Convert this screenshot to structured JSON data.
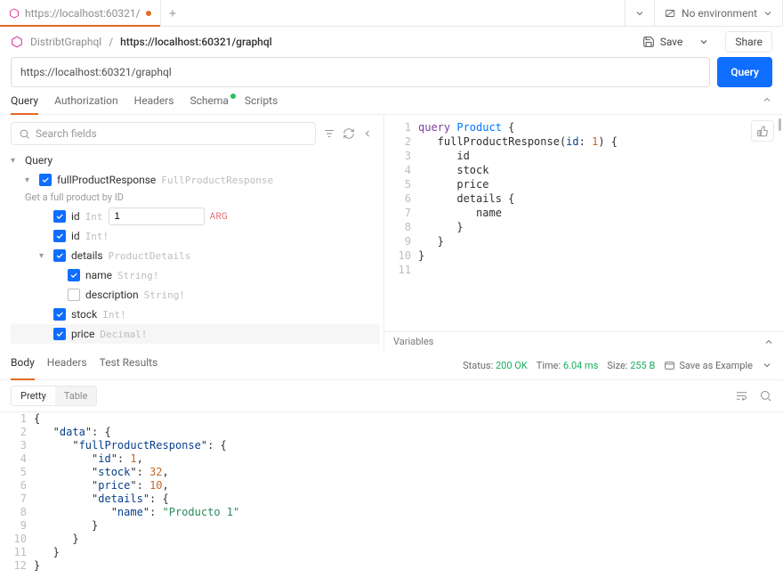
{
  "tab": {
    "url": "https://localhost:60321/",
    "unsaved": true
  },
  "env": {
    "label": "No environment"
  },
  "breadcrumb": {
    "collection": "DistribtGraphql",
    "item": "https://localhost:60321/graphql"
  },
  "actions": {
    "save": "Save",
    "share": "Share",
    "query": "Query"
  },
  "url": "https://localhost:60321/graphql",
  "subtabs": [
    "Query",
    "Authorization",
    "Headers",
    "Schema",
    "Scripts"
  ],
  "schema_dot_tab": "Schema",
  "search_placeholder": "Search fields",
  "schema": {
    "root": "Query",
    "field": {
      "name": "fullProductResponse",
      "type": "FullProductResponse",
      "desc": "Get a full product by ID",
      "arg": {
        "name": "id",
        "type": "Int",
        "value": "1",
        "tag": "ARG"
      },
      "children": [
        {
          "name": "id",
          "type": "Int!",
          "checked": true
        },
        {
          "name": "details",
          "type": "ProductDetails",
          "checked": true,
          "expand": true,
          "children": [
            {
              "name": "name",
              "type": "String!",
              "checked": true
            },
            {
              "name": "description",
              "type": "String!",
              "checked": false
            }
          ]
        },
        {
          "name": "stock",
          "type": "Int!",
          "checked": true
        },
        {
          "name": "price",
          "type": "Decimal!",
          "checked": true,
          "selected": true
        }
      ]
    }
  },
  "editor": {
    "lines": [
      [
        {
          "t": "query ",
          "c": "purple"
        },
        {
          "t": "Product",
          "c": "blue"
        },
        {
          "t": " {",
          "c": ""
        }
      ],
      [
        {
          "t": "   fullProductResponse(",
          "c": ""
        },
        {
          "t": "id",
          "c": "darkblue"
        },
        {
          "t": ": ",
          "c": ""
        },
        {
          "t": "1",
          "c": "orange"
        },
        {
          "t": ") {",
          "c": ""
        }
      ],
      [
        {
          "t": "      id",
          "c": ""
        }
      ],
      [
        {
          "t": "      stock",
          "c": ""
        }
      ],
      [
        {
          "t": "      price",
          "c": ""
        }
      ],
      [
        {
          "t": "      details {",
          "c": ""
        }
      ],
      [
        {
          "t": "         name",
          "c": ""
        }
      ],
      [
        {
          "t": "      }",
          "c": ""
        }
      ],
      [
        {
          "t": "   }",
          "c": ""
        }
      ],
      [
        {
          "t": "}",
          "c": ""
        }
      ],
      [
        {
          "t": "",
          "c": ""
        }
      ]
    ]
  },
  "variables_label": "Variables",
  "response": {
    "tabs": [
      "Body",
      "Headers",
      "Test Results"
    ],
    "status_label": "Status:",
    "status": "200 OK",
    "time_label": "Time:",
    "time": "6.04 ms",
    "size_label": "Size:",
    "size": "255 B",
    "save_example": "Save as Example",
    "view": {
      "pretty": "Pretty",
      "table": "Table"
    },
    "lines": [
      [
        {
          "t": "{",
          "c": ""
        }
      ],
      [
        {
          "t": "   \"",
          "c": ""
        },
        {
          "t": "data",
          "c": "darkblue"
        },
        {
          "t": "\": {",
          "c": ""
        }
      ],
      [
        {
          "t": "      \"",
          "c": ""
        },
        {
          "t": "fullProductResponse",
          "c": "darkblue"
        },
        {
          "t": "\": {",
          "c": ""
        }
      ],
      [
        {
          "t": "         \"",
          "c": ""
        },
        {
          "t": "id",
          "c": "darkblue"
        },
        {
          "t": "\": ",
          "c": ""
        },
        {
          "t": "1",
          "c": "orange"
        },
        {
          "t": ",",
          "c": ""
        }
      ],
      [
        {
          "t": "         \"",
          "c": ""
        },
        {
          "t": "stock",
          "c": "darkblue"
        },
        {
          "t": "\": ",
          "c": ""
        },
        {
          "t": "32",
          "c": "orange"
        },
        {
          "t": ",",
          "c": ""
        }
      ],
      [
        {
          "t": "         \"",
          "c": ""
        },
        {
          "t": "price",
          "c": "darkblue"
        },
        {
          "t": "\": ",
          "c": ""
        },
        {
          "t": "10",
          "c": "orange"
        },
        {
          "t": ",",
          "c": ""
        }
      ],
      [
        {
          "t": "         \"",
          "c": ""
        },
        {
          "t": "details",
          "c": "darkblue"
        },
        {
          "t": "\": {",
          "c": ""
        }
      ],
      [
        {
          "t": "            \"",
          "c": ""
        },
        {
          "t": "name",
          "c": "darkblue"
        },
        {
          "t": "\": ",
          "c": ""
        },
        {
          "t": "\"Producto 1\"",
          "c": "greenstr"
        }
      ],
      [
        {
          "t": "         }",
          "c": ""
        }
      ],
      [
        {
          "t": "      }",
          "c": ""
        }
      ],
      [
        {
          "t": "   }",
          "c": ""
        }
      ],
      [
        {
          "t": "}",
          "c": ""
        }
      ]
    ]
  }
}
